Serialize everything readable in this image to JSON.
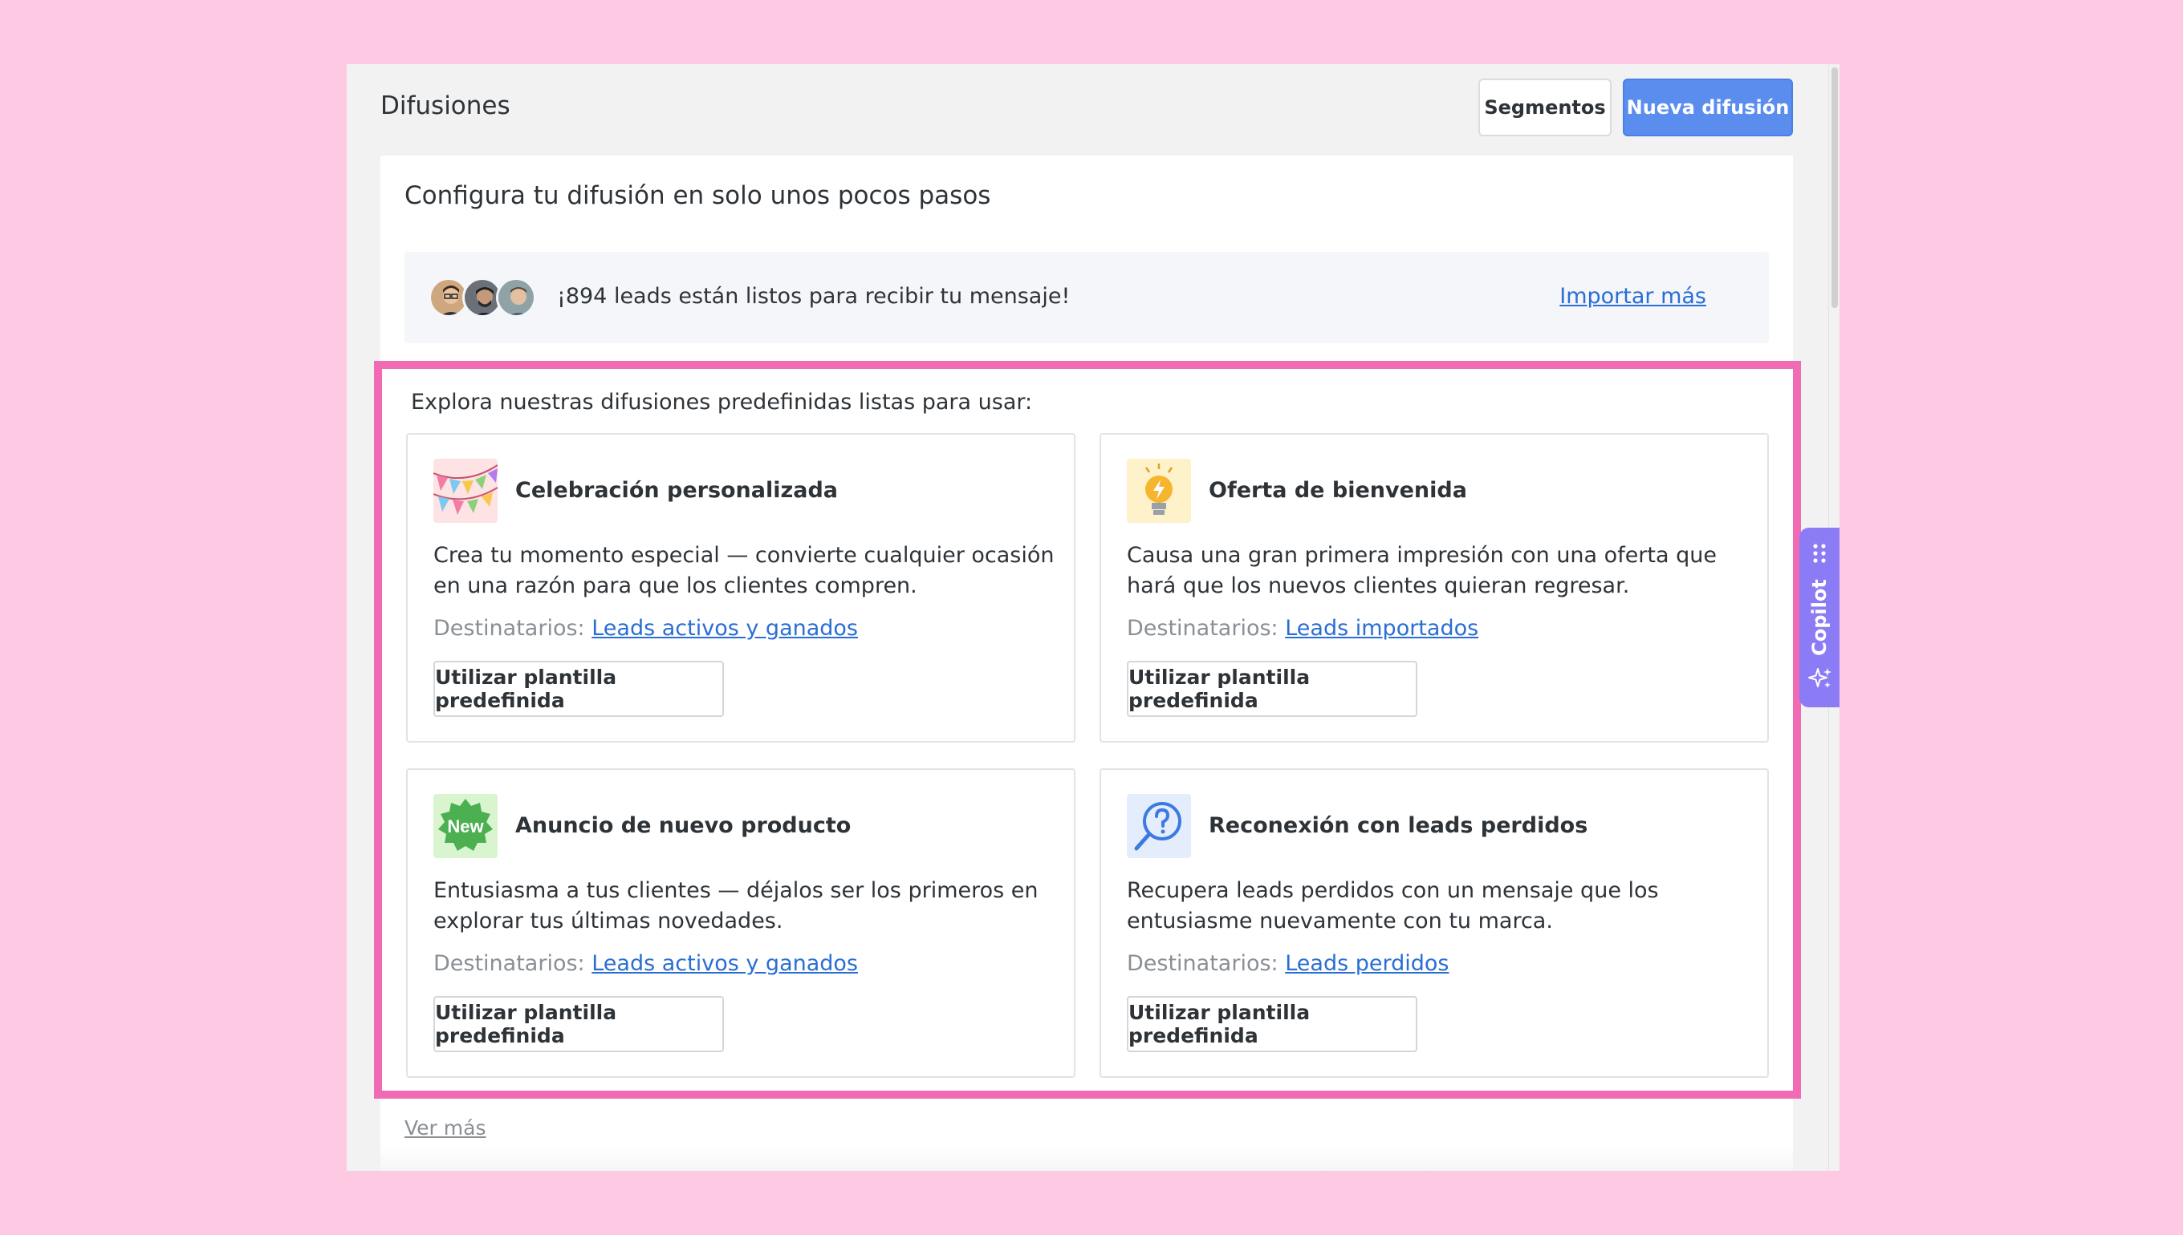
{
  "header": {
    "title": "Difusiones",
    "segments_label": "Segmentos",
    "new_label": "Nueva difusión"
  },
  "main": {
    "title": "Configura tu difusión en solo unos pocos pasos",
    "leads_text": "¡894 leads están listos para recibir tu mensaje!",
    "import_label": "Importar más",
    "avatars": [
      "avatar-1",
      "avatar-2",
      "avatar-3"
    ]
  },
  "templates": {
    "intro": "Explora nuestras difusiones predefinidas listas para usar:",
    "recipients_label": "Destinatarios:",
    "button_label": "Utilizar plantilla predefinida",
    "items": [
      {
        "icon": "party-flags-icon",
        "title": "Celebración personalizada",
        "desc": "Crea tu momento especial — convierte cualquier ocasión en una razón para que los clientes compren.",
        "recipients": "Leads activos y ganados"
      },
      {
        "icon": "lightbulb-icon",
        "title": "Oferta de bienvenida",
        "desc": "Causa una gran primera impresión con una oferta que hará que los nuevos clientes quieran regresar.",
        "recipients": "Leads importados"
      },
      {
        "icon": "new-badge-icon",
        "title": "Anuncio de nuevo producto",
        "desc": "Entusiasma a tus clientes — déjalos ser los primeros en explorar tus últimas novedades.",
        "recipients": "Leads activos y ganados",
        "badge_text": "New"
      },
      {
        "icon": "search-question-icon",
        "title": "Reconexión con leads perdidos",
        "desc": "Recupera leads perdidos con un mensaje que los entusiasme nuevamente con tu marca.",
        "recipients": "Leads perdidos"
      }
    ]
  },
  "footer": {
    "see_more": "Ver más"
  },
  "copilot": {
    "label": "Copilot"
  },
  "colors": {
    "background": "#fdc9e3",
    "accent": "#5b8def",
    "highlight": "#f06bb3",
    "copilot": "#8b7cf6",
    "link": "#2a6ed4"
  }
}
